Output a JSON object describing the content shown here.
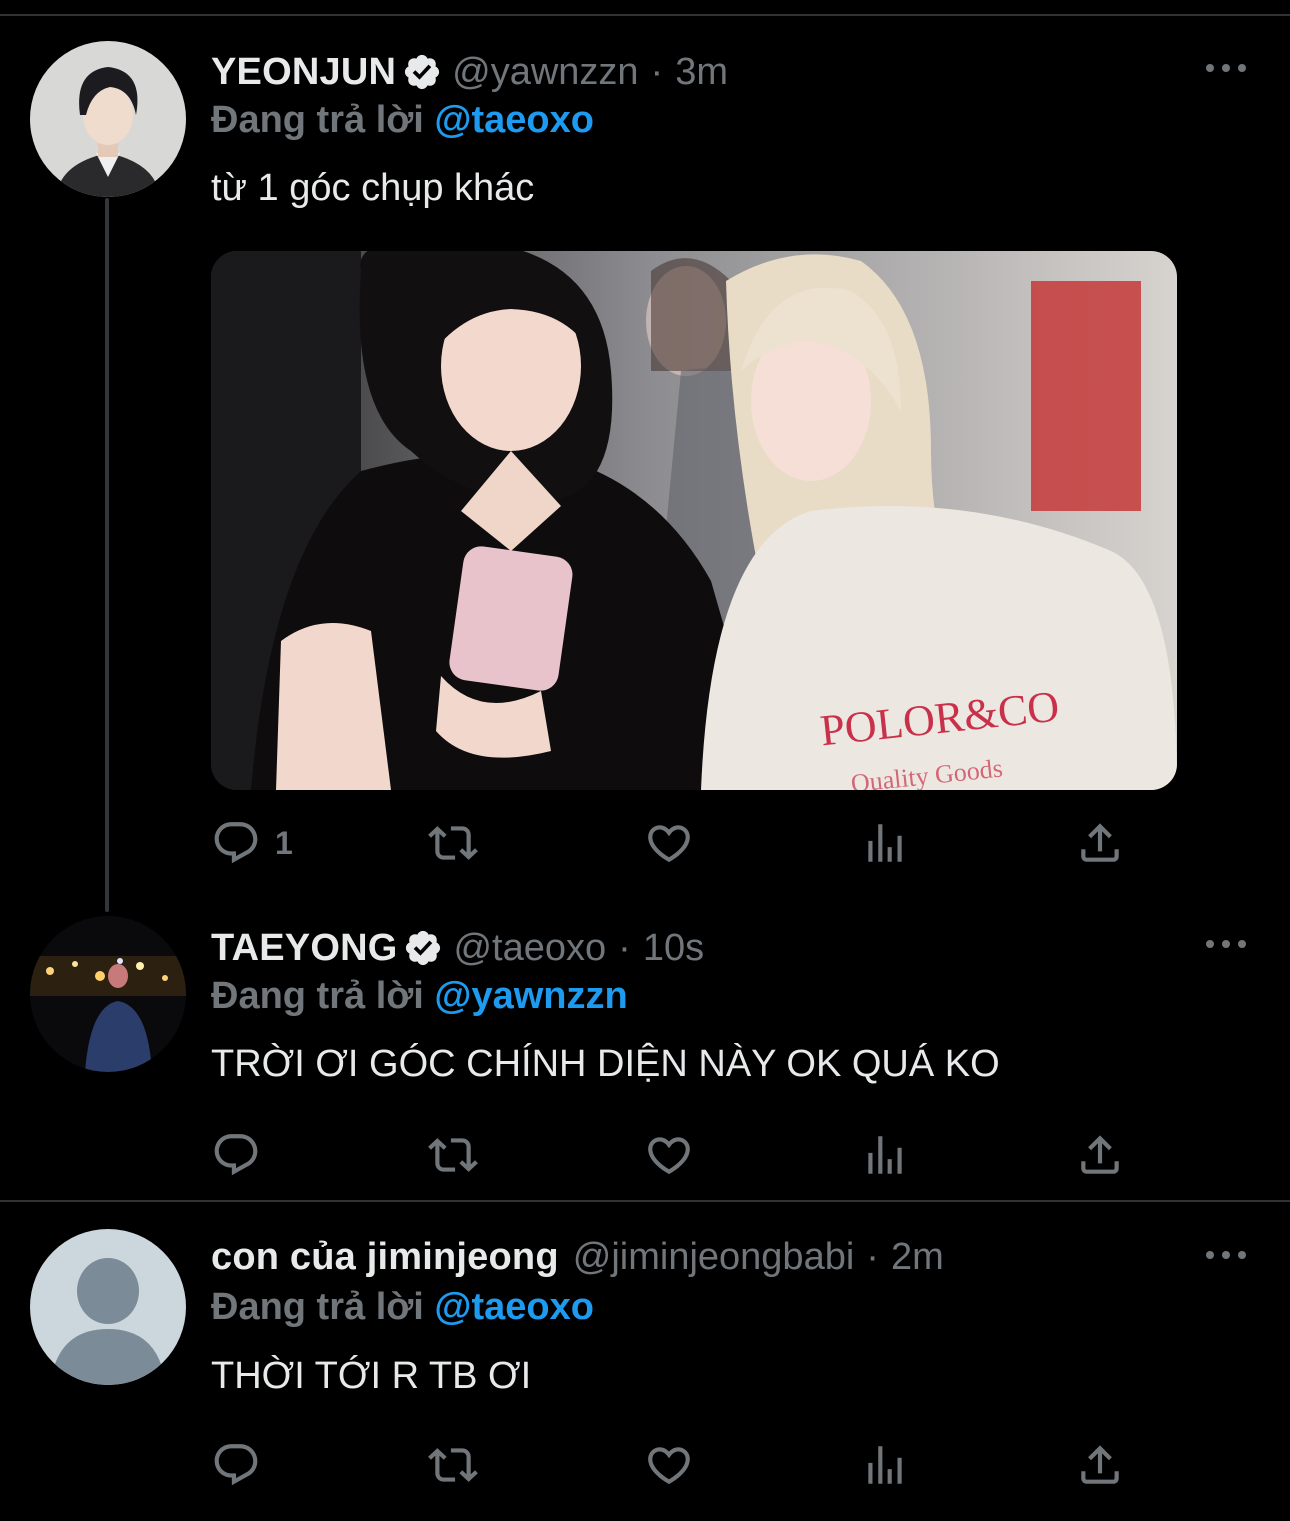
{
  "tweets": [
    {
      "display_name": "YEONJUN",
      "handle": "@yawnzzn",
      "separator": "·",
      "time": "3m",
      "reply_prefix": "Đang trả lời",
      "reply_to": "@taeoxo",
      "text": "từ 1 góc chụp khác",
      "verified": true,
      "has_media": true,
      "actions": {
        "reply_count": "1"
      }
    },
    {
      "display_name": "TAEYONG",
      "handle": "@taeoxo",
      "separator": "·",
      "time": "10s",
      "reply_prefix": "Đang trả lời",
      "reply_to": "@yawnzzn",
      "text": "TRỜI ƠI GÓC CHÍNH DIỆN NÀY OK QUÁ KO",
      "verified": true,
      "has_media": false
    },
    {
      "display_name": "con của jiminjeong",
      "handle": "@jiminjeongbabi",
      "separator": "·",
      "time": "2m",
      "reply_prefix": "Đang trả lời",
      "reply_to": "@taeoxo",
      "text": "THỜI TỚI R TB ƠI",
      "verified": false,
      "has_media": false
    }
  ],
  "icons": {
    "reply": "reply-icon",
    "retweet": "retweet-icon",
    "like": "heart-icon",
    "views": "analytics-icon",
    "share": "share-icon",
    "more": "more-icon",
    "verified": "verified-badge-icon"
  },
  "colors": {
    "background": "#000000",
    "text": "#e7e9ea",
    "secondary": "#71767b",
    "accent": "#1d9bf0",
    "divider": "#2f3336"
  }
}
